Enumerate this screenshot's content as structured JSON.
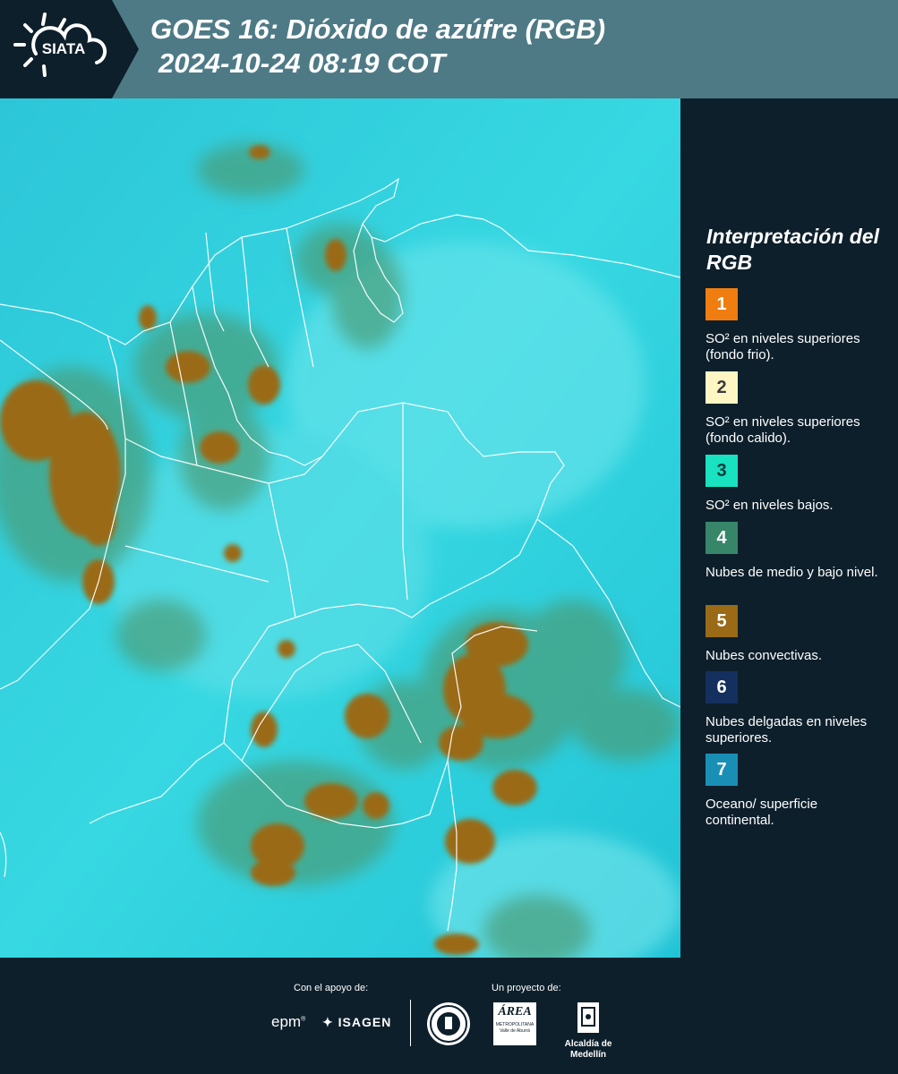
{
  "header": {
    "title_line1": "GOES 16: Dióxido de azúfre (RGB)",
    "title_line2": "2024-10-24 08:19 COT",
    "logo_text": "SIATA"
  },
  "legend": {
    "title": "Interpretación del RGB",
    "items": [
      {
        "number": "1",
        "color": "#f07d10",
        "text_color": "#ffffff",
        "label": "SO² en niveles superiores (fondo frio)."
      },
      {
        "number": "2",
        "color": "#fff6c3",
        "text_color": "#3a3a3a",
        "label": "SO² en niveles superiores (fondo calido)."
      },
      {
        "number": "3",
        "color": "#18e2c0",
        "text_color": "#0d3a3a",
        "label": "SO² en niveles bajos."
      },
      {
        "number": "4",
        "color": "#37866a",
        "text_color": "#ffffff",
        "label": "Nubes de medio y bajo nivel."
      },
      {
        "number": "5",
        "color": "#9a6a16",
        "text_color": "#ffffff",
        "label": "Nubes convectivas."
      },
      {
        "number": "6",
        "color": "#14305e",
        "text_color": "#ffffff",
        "label": "Nubes delgadas en niveles superiores."
      },
      {
        "number": "7",
        "color": "#1a8fb6",
        "text_color": "#ffffff",
        "label": "Oceano/ superficie continental."
      }
    ]
  },
  "footer": {
    "support_label": "Con el apoyo de:",
    "project_label": "Un proyecto de:",
    "sponsor1": "epm",
    "sponsor2": "ISAGEN",
    "partner1_line1": "ÁREA",
    "partner1_line2": "METROPOLITANA",
    "partner1_line3": "Valle de Aburrá",
    "partner2": "Alcaldía de Medellín"
  }
}
